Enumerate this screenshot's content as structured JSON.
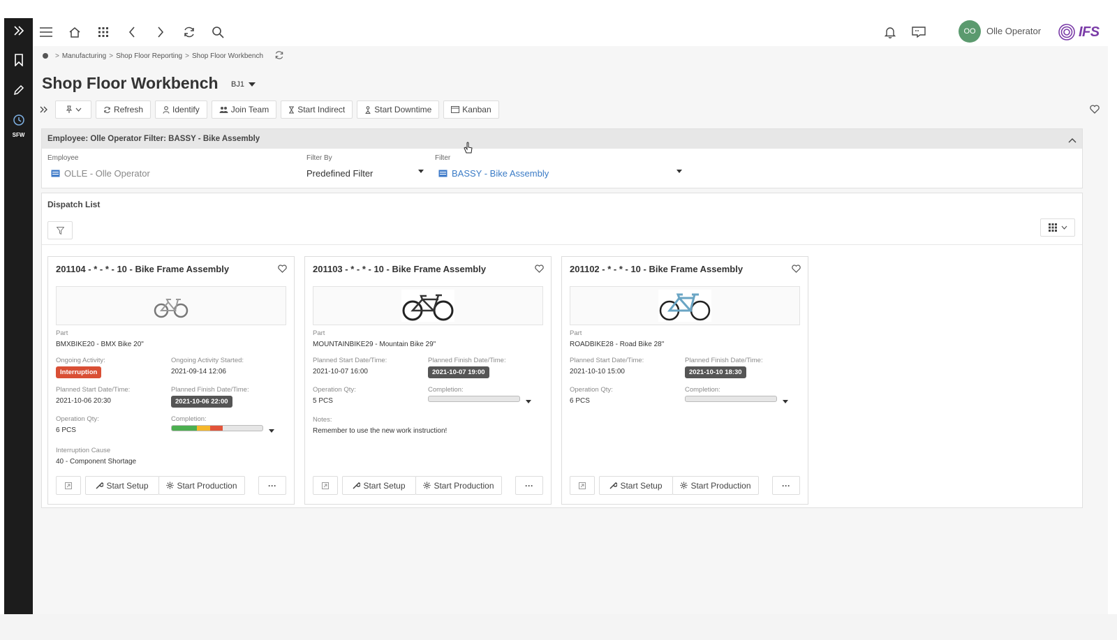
{
  "app": {
    "user_initials": "OO",
    "user_name": "Olle Operator",
    "logo_text": "IFS",
    "brand_color": "#7a3ba7",
    "rail": {
      "sfw_label": "SFW"
    }
  },
  "breadcrumb": {
    "items": [
      "Manufacturing",
      "Shop Floor Reporting",
      "Shop Floor Workbench"
    ],
    "separator": ">"
  },
  "page": {
    "title": "Shop Floor Workbench",
    "context": "BJ1"
  },
  "toolbar": {
    "refresh": "Refresh",
    "identify": "Identify",
    "join_team": "Join Team",
    "start_indirect": "Start Indirect",
    "start_downtime": "Start Downtime",
    "kanban": "Kanban"
  },
  "filter_panel": {
    "header": "Employee: Olle Operator Filter: BASSY - Bike Assembly",
    "employee_label": "Employee",
    "employee_value": "OLLE - Olle Operator",
    "filter_by_label": "Filter By",
    "filter_by_value": "Predefined Filter",
    "filter_label": "Filter",
    "filter_value": "BASSY - Bike Assembly"
  },
  "dispatch_list": {
    "title": "Dispatch List",
    "cards": [
      {
        "title": "201104 - * - * - 10 - Bike Frame Assembly",
        "image": "bmx-bike",
        "part_label": "Part",
        "part_value": "BMXBIKE20 - BMX Bike 20\"",
        "ongoing_label": "Ongoing Activity:",
        "ongoing_value": "Interruption",
        "ongoing_started_label": "Ongoing Activity Started:",
        "ongoing_started_value": "2021-09-14 12:06",
        "planned_start_label": "Planned Start Date/Time:",
        "planned_start_value": "2021-10-06 20:30",
        "planned_finish_label": "Planned Finish Date/Time:",
        "planned_finish_value": "2021-10-06 22:00",
        "qty_label": "Operation Qty:",
        "qty_value": "6 PCS",
        "completion_label": "Completion:",
        "completion_segments": [
          {
            "color": "#4caf50",
            "fraction": 0.28
          },
          {
            "color": "#f5b72b",
            "fraction": 0.14
          },
          {
            "color": "#e2543a",
            "fraction": 0.14
          }
        ],
        "cause_label": "Interruption Cause",
        "cause_value": "40 - Component Shortage",
        "start_setup": "Start Setup",
        "start_production": "Start Production",
        "more": "···"
      },
      {
        "title": "201103 - * - * - 10 - Bike Frame Assembly",
        "image": "mountain-bike",
        "part_label": "Part",
        "part_value": "MOUNTAINBIKE29 - Mountain Bike 29\"",
        "planned_start_label": "Planned Start Date/Time:",
        "planned_start_value": "2021-10-07 16:00",
        "planned_finish_label": "Planned Finish Date/Time:",
        "planned_finish_value": "2021-10-07 19:00",
        "qty_label": "Operation Qty:",
        "qty_value": "5 PCS",
        "completion_label": "Completion:",
        "notes_label": "Notes:",
        "notes_value": "Remember to use the new work instruction!",
        "start_setup": "Start Setup",
        "start_production": "Start Production",
        "more": "···"
      },
      {
        "title": "201102 - * - * - 10 - Bike Frame Assembly",
        "image": "road-bike",
        "part_label": "Part",
        "part_value": "ROADBIKE28 - Road Bike 28\"",
        "planned_start_label": "Planned Start Date/Time:",
        "planned_start_value": "2021-10-10 15:00",
        "planned_finish_label": "Planned Finish Date/Time:",
        "planned_finish_value": "2021-10-10 18:30",
        "qty_label": "Operation Qty:",
        "qty_value": "6 PCS",
        "completion_label": "Completion:",
        "start_setup": "Start Setup",
        "start_production": "Start Production",
        "more": "···"
      }
    ]
  }
}
